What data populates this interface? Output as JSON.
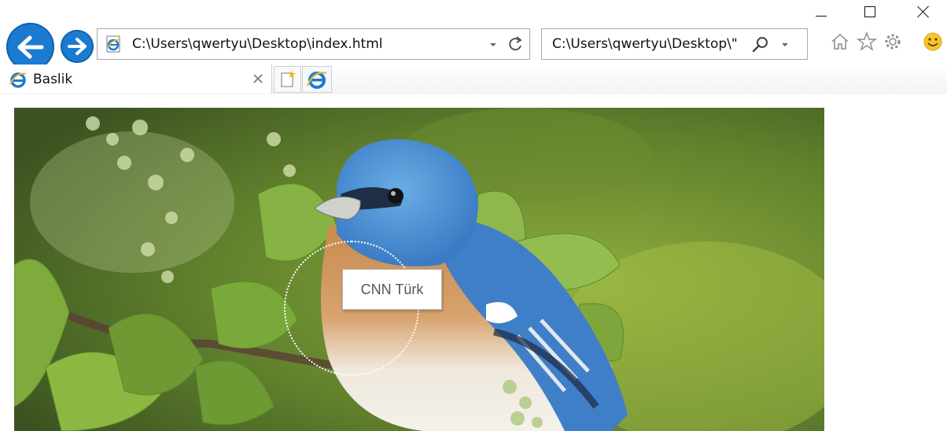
{
  "window": {
    "minimize_icon": "minimize-icon",
    "maximize_icon": "maximize-icon",
    "close_icon": "close-icon"
  },
  "nav": {
    "back_icon": "back-arrow-icon",
    "forward_icon": "forward-arrow-icon",
    "accent_color": "#1a7bd0"
  },
  "address_bar": {
    "url": "C:\\Users\\qwertyu\\Desktop\\index.html",
    "favicon": "ie-page-icon",
    "dropdown_icon": "chevron-down-icon",
    "refresh_icon": "refresh-icon"
  },
  "search_bar": {
    "value": "C:\\Users\\qwertyu\\Desktop\\\"",
    "search_icon": "search-icon",
    "dropdown_icon": "chevron-down-icon"
  },
  "toolbar": {
    "home_icon": "home-icon",
    "favorites_icon": "star-icon",
    "tools_icon": "gear-icon",
    "feedback_icon": "smiley-icon"
  },
  "tabs": [
    {
      "label": "Baslik",
      "icon": "ie-icon",
      "close_icon": "close-icon"
    }
  ],
  "tab_actions": {
    "new_tab_icon": "new-tab-icon",
    "ie_icon": "ie-icon"
  },
  "content": {
    "image": "bluebird-photo",
    "tooltip": "CNN Türk"
  }
}
